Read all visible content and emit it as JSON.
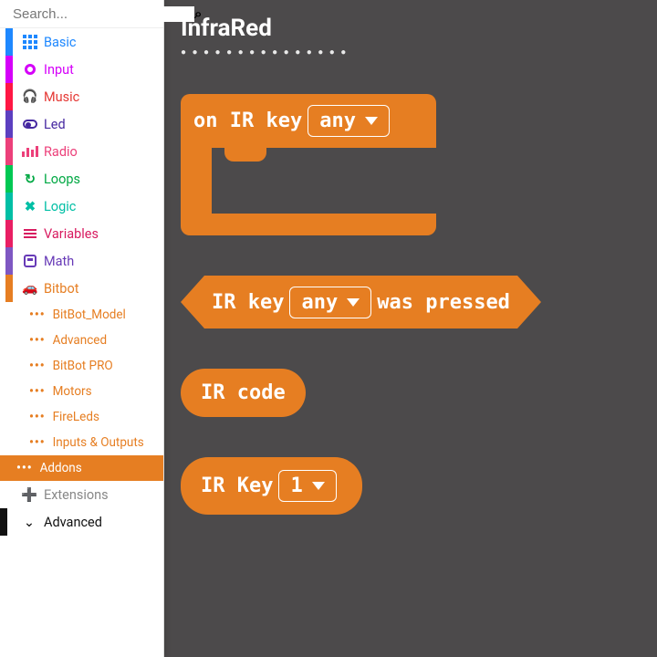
{
  "search": {
    "placeholder": "Search..."
  },
  "sidebar": {
    "items": [
      {
        "label": "Basic",
        "color": "#1e88ff",
        "accent": "#1e88ff",
        "icon": "grid"
      },
      {
        "label": "Input",
        "color": "#d500f9",
        "accent": "#d500f9",
        "icon": "donut"
      },
      {
        "label": "Music",
        "color": "#ff1744",
        "accent": "#e53935",
        "icon": "headphones"
      },
      {
        "label": "Led",
        "color": "#5c3fc0",
        "accent": "#4527a0",
        "icon": "toggle"
      },
      {
        "label": "Radio",
        "color": "#ec407a",
        "accent": "#ec407a",
        "icon": "bars"
      },
      {
        "label": "Loops",
        "color": "#00c853",
        "accent": "#00a843",
        "icon": "loop"
      },
      {
        "label": "Logic",
        "color": "#00bfa5",
        "accent": "#00bfa5",
        "icon": "shuffle"
      },
      {
        "label": "Variables",
        "color": "#e91e63",
        "accent": "#d81b60",
        "icon": "list"
      },
      {
        "label": "Math",
        "color": "#7e57c2",
        "accent": "#673ab7",
        "icon": "calc"
      },
      {
        "label": "Bitbot",
        "color": "#e67e22",
        "accent": "#e67e22",
        "icon": "car"
      }
    ],
    "bitbot_sub": [
      {
        "label": "BitBot_Model"
      },
      {
        "label": "Advanced"
      },
      {
        "label": "BitBot PRO"
      },
      {
        "label": "Motors"
      },
      {
        "label": "FireLeds"
      },
      {
        "label": "Inputs & Outputs"
      },
      {
        "label": "Addons",
        "active": true
      }
    ],
    "extensions_label": "Extensions",
    "advanced_label": "Advanced"
  },
  "canvas": {
    "title": "InfraRed",
    "blocks": {
      "hat_prefix": "on IR key",
      "hat_dd": "any",
      "hex_prefix": "IR key",
      "hex_dd": "any",
      "hex_suffix": "was pressed",
      "pill1": "IR code",
      "pill2_prefix": "IR Key",
      "pill2_dd": "1"
    }
  }
}
